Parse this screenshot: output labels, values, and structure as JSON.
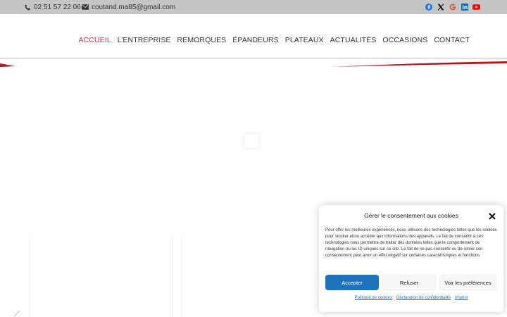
{
  "topbar": {
    "phone": "02 51 57 22 06",
    "email": "coutand.ma85@gmail.com",
    "socials": [
      "facebook-icon",
      "x-icon",
      "google-icon",
      "linkedin-icon",
      "youtube-icon"
    ]
  },
  "nav": {
    "items": [
      {
        "label": "ACCUEIL",
        "active": true
      },
      {
        "label": "L’ENTREPRISE"
      },
      {
        "label": "REMORQUES"
      },
      {
        "label": "ÉPANDEURS"
      },
      {
        "label": "PLATEAUX"
      },
      {
        "label": "ACTUALITÉS"
      },
      {
        "label": "OCCASIONS"
      },
      {
        "label": "CONTACT"
      }
    ]
  },
  "colors": {
    "accent": "#d2334c",
    "swoosh": "#b3151f",
    "topbar": "#c5c5c5",
    "button_primary": "#1e73be"
  },
  "cookie": {
    "title": "Gérer le consentement aux cookies",
    "body": "Pour offrir les meilleures expériences, nous utilisons des technologies telles que les cookies pour stocker et/ou accéder aux informations des appareils. Le fait de consentir à ces technologies nous permettra de traiter des données telles que le comportement de navigation ou les ID uniques sur ce site. Le fait de ne pas consentir ou de retirer son consentement peut avoir un effet négatif sur certaines caractéristiques et fonctions.",
    "accept": "Accepter",
    "refuse": "Refuser",
    "preferences": "Voir les préférences",
    "links": [
      "Politique de cookies",
      "Déclaration de confidentialité",
      "Imprint"
    ]
  }
}
